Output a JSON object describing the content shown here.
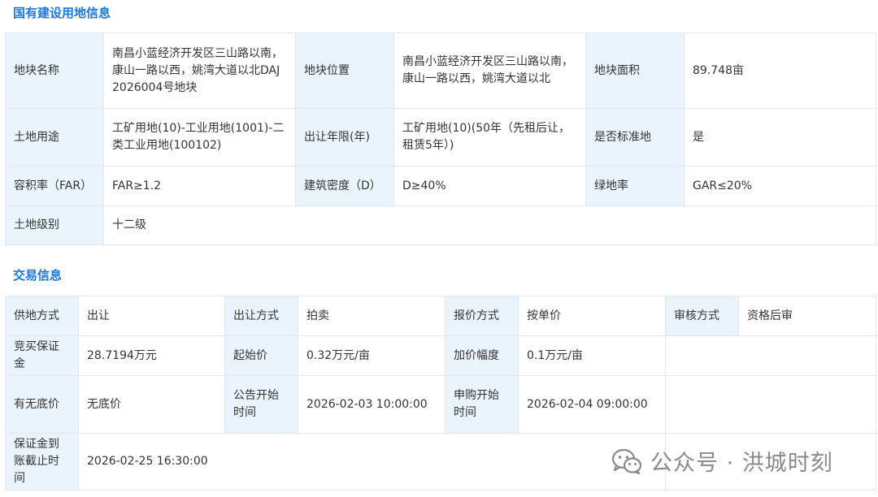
{
  "section1": {
    "title": "国有建设用地信息",
    "rows": [
      [
        {
          "label": "地块名称",
          "value": "南昌小蓝经济开发区三山路以南，康山一路以西，姚湾大道以北DAJ2026004号地块"
        },
        {
          "label": "地块位置",
          "value": "南昌小蓝经济开发区三山路以南，康山一路以西，姚湾大道以北"
        },
        {
          "label": "地块面积",
          "value": "89.748亩"
        }
      ],
      [
        {
          "label": "土地用途",
          "value": "工矿用地(10)-工业用地(1001)-二类工业用地(100102)"
        },
        {
          "label": "出让年限(年)",
          "value": "工矿用地(10)(50年（先租后让，租赁5年）)"
        },
        {
          "label": "是否标准地",
          "value": "是"
        }
      ],
      [
        {
          "label": "容积率（FAR）",
          "value": "FAR≥1.2"
        },
        {
          "label": "建筑密度（D）",
          "value": "D≥40%"
        },
        {
          "label": "绿地率",
          "value": "GAR≤20%"
        }
      ],
      [
        {
          "label": "土地级别",
          "value": "十二级"
        }
      ]
    ]
  },
  "section2": {
    "title": "交易信息",
    "rows": [
      [
        {
          "label": "供地方式",
          "value": "出让"
        },
        {
          "label": "出让方式",
          "value": "拍卖"
        },
        {
          "label": "报价方式",
          "value": "按单价"
        },
        {
          "label": "审核方式",
          "value": "资格后审"
        }
      ],
      [
        {
          "label": "竞买保证金",
          "value": "28.7194万元"
        },
        {
          "label": "起始价",
          "value": "0.32万元/亩"
        },
        {
          "label": "加价幅度",
          "value": "0.1万元/亩"
        }
      ],
      [
        {
          "label": "有无底价",
          "value": "无底价"
        },
        {
          "label": "公告开始时间",
          "value": "2026-02-03 10:00:00"
        },
        {
          "label": "申购开始时间",
          "value": "2026-02-04 09:00:00"
        }
      ],
      [
        {
          "label": "保证金到账截止时间",
          "value": "2026-02-25 16:30:00"
        }
      ]
    ]
  },
  "watermark": {
    "text": "公众号 · 洪城时刻",
    "icon": "wechat-icon"
  }
}
